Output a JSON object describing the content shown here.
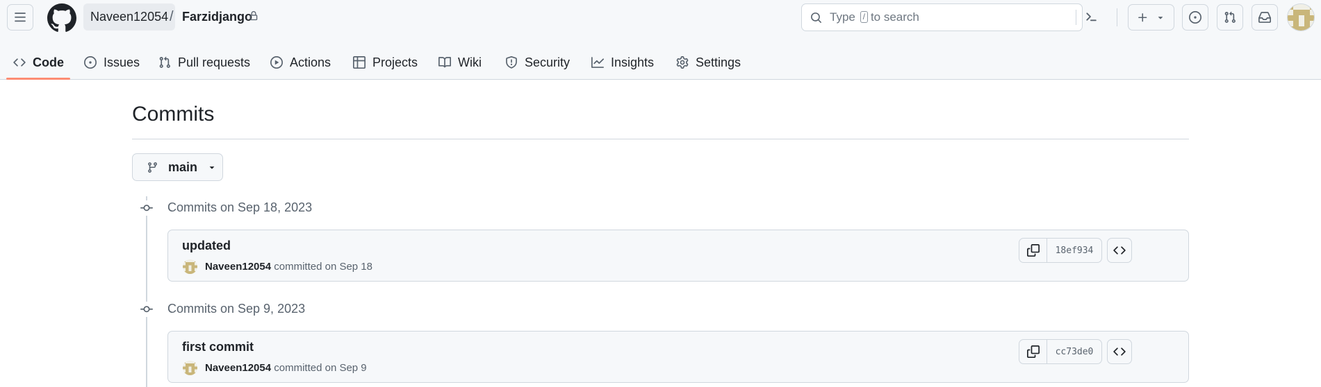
{
  "header": {
    "owner": "Naveen12054",
    "separator": "/",
    "repo": "Farzidjango",
    "search": {
      "prefix": "Type",
      "key": "/",
      "suffix": "to search"
    }
  },
  "nav": {
    "items": [
      {
        "label": "Code",
        "icon": "code-icon",
        "selected": true
      },
      {
        "label": "Issues",
        "icon": "issue-opened-icon"
      },
      {
        "label": "Pull requests",
        "icon": "git-pull-request-icon"
      },
      {
        "label": "Actions",
        "icon": "play-icon"
      },
      {
        "label": "Projects",
        "icon": "table-icon"
      },
      {
        "label": "Wiki",
        "icon": "book-icon"
      },
      {
        "label": "Security",
        "icon": "shield-icon"
      },
      {
        "label": "Insights",
        "icon": "graph-icon"
      },
      {
        "label": "Settings",
        "icon": "gear-icon"
      }
    ]
  },
  "page": {
    "title": "Commits",
    "branch": "main"
  },
  "commit_groups": [
    {
      "heading": "Commits on Sep 18, 2023",
      "commits": [
        {
          "message": "updated",
          "author": "Naveen12054",
          "meta": "committed on Sep 18",
          "sha": "18ef934"
        }
      ]
    },
    {
      "heading": "Commits on Sep 9, 2023",
      "commits": [
        {
          "message": "first commit",
          "author": "Naveen12054",
          "meta": "committed on Sep 9",
          "sha": "cc73de0"
        }
      ]
    }
  ],
  "colors": {
    "header_bg": "#f6f8fa",
    "border": "#d0d7de",
    "selected_underline": "#fd8c73",
    "muted_text": "#59636e",
    "avatar_identicon": "#c9b67a"
  }
}
